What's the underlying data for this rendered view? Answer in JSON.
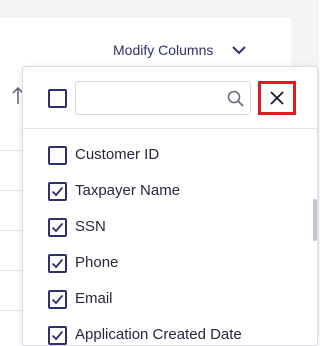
{
  "toolbar": {
    "modify_columns_label": "Modify Columns"
  },
  "column_picker": {
    "search": {
      "value": "",
      "placeholder": ""
    },
    "select_all_checked": false,
    "items": [
      {
        "label": "Customer ID",
        "checked": false
      },
      {
        "label": "Taxpayer Name",
        "checked": true
      },
      {
        "label": "SSN",
        "checked": true
      },
      {
        "label": "Phone",
        "checked": true
      },
      {
        "label": "Email",
        "checked": true
      },
      {
        "label": "Application Created Date",
        "checked": true
      }
    ]
  },
  "colors": {
    "accent": "#2e3170",
    "close_highlight": "#e01a22",
    "page_bg": "#f4f4f6"
  },
  "icons": {
    "sort": "sort-arrow-icon",
    "dropdown": "chevron-down-icon",
    "search": "search-icon",
    "close": "close-icon",
    "check": "checkmark-icon"
  }
}
